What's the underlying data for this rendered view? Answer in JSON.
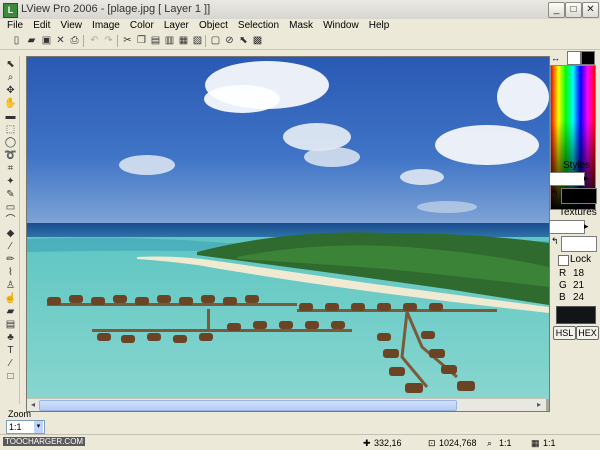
{
  "window": {
    "title": "LView Pro 2006 - [plage.jpg [ Layer 1 ]]",
    "min_label": "_",
    "max_label": "□",
    "close_label": "✕"
  },
  "menu": [
    "File",
    "Edit",
    "View",
    "Image",
    "Color",
    "Layer",
    "Object",
    "Selection",
    "Mask",
    "Window",
    "Help"
  ],
  "panel": {
    "styles_label": "Styles",
    "textures_label": "Textures",
    "lock_label": "Lock",
    "rgb": [
      {
        "channel": "R",
        "value": "18"
      },
      {
        "channel": "G",
        "value": "21"
      },
      {
        "channel": "B",
        "value": "24"
      }
    ],
    "hsl_label": "HSL",
    "hex_label": "HEX"
  },
  "zoom": {
    "label": "Zoom",
    "value": "1:1"
  },
  "status": {
    "cursor_pos": "332,16",
    "image_size": "1024,768",
    "ratio_a": "1:1",
    "ratio_b": "1:1"
  },
  "watermark": "TOOCHARGER.COM",
  "colors": {
    "foreground": "#000000",
    "background": "#ffffff",
    "current_color": "#121518",
    "scroll_thumb": "#b5cdf5"
  }
}
